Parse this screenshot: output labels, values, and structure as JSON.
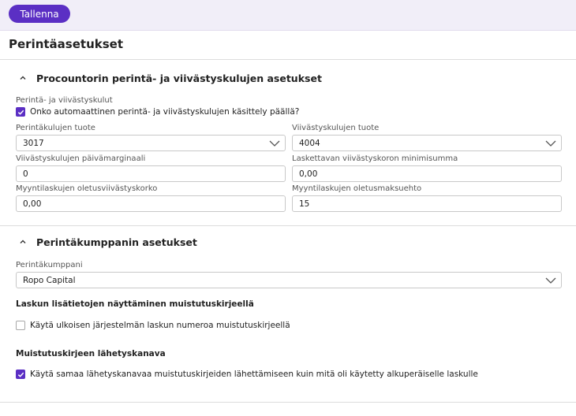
{
  "toolbar": {
    "save_label": "Tallenna"
  },
  "page_title": "Perintäasetukset",
  "section1": {
    "title": "Procountorin perintä- ja viivästyskulujen asetukset",
    "costs_label": "Perintä- ja viivästyskulut",
    "auto_handling": {
      "label": "Onko automaattinen perintä- ja viivästyskulujen käsittely päällä?",
      "checked": true
    },
    "collection_product": {
      "label": "Perintäkulujen tuote",
      "value": "3017"
    },
    "delay_product": {
      "label": "Viivästyskulujen tuote",
      "value": "4004"
    },
    "delay_day_margin": {
      "label": "Viivästyskulujen päivämarginaali",
      "value": "0"
    },
    "min_interest": {
      "label": "Laskettavan viivästyskoron minimisumma",
      "value": "0,00"
    },
    "default_interest": {
      "label": "Myyntilaskujen oletusviivästyskorko",
      "value": "0,00"
    },
    "default_payment_term": {
      "label": "Myyntilaskujen oletusmaksuehto",
      "value": "15"
    }
  },
  "section2": {
    "title": "Perintäkumppanin asetukset",
    "partner": {
      "label": "Perintäkumppani",
      "value": "Ropo Capital"
    },
    "extra_info_heading": "Laskun lisätietojen näyttäminen muistutuskirjeellä",
    "external_number": {
      "label": "Käytä ulkoisen järjestelmän laskun numeroa muistutuskirjeellä",
      "checked": false
    },
    "channel_heading": "Muistutuskirjeen lähetyskanava",
    "same_channel": {
      "label": "Käytä samaa lähetyskanavaa muistutuskirjeiden lähettämiseen kuin mitä oli käytetty alkuperäiselle laskulle",
      "checked": true
    }
  },
  "colors": {
    "accent": "#5b2fc4",
    "topbar_bg": "#f1eef8"
  }
}
